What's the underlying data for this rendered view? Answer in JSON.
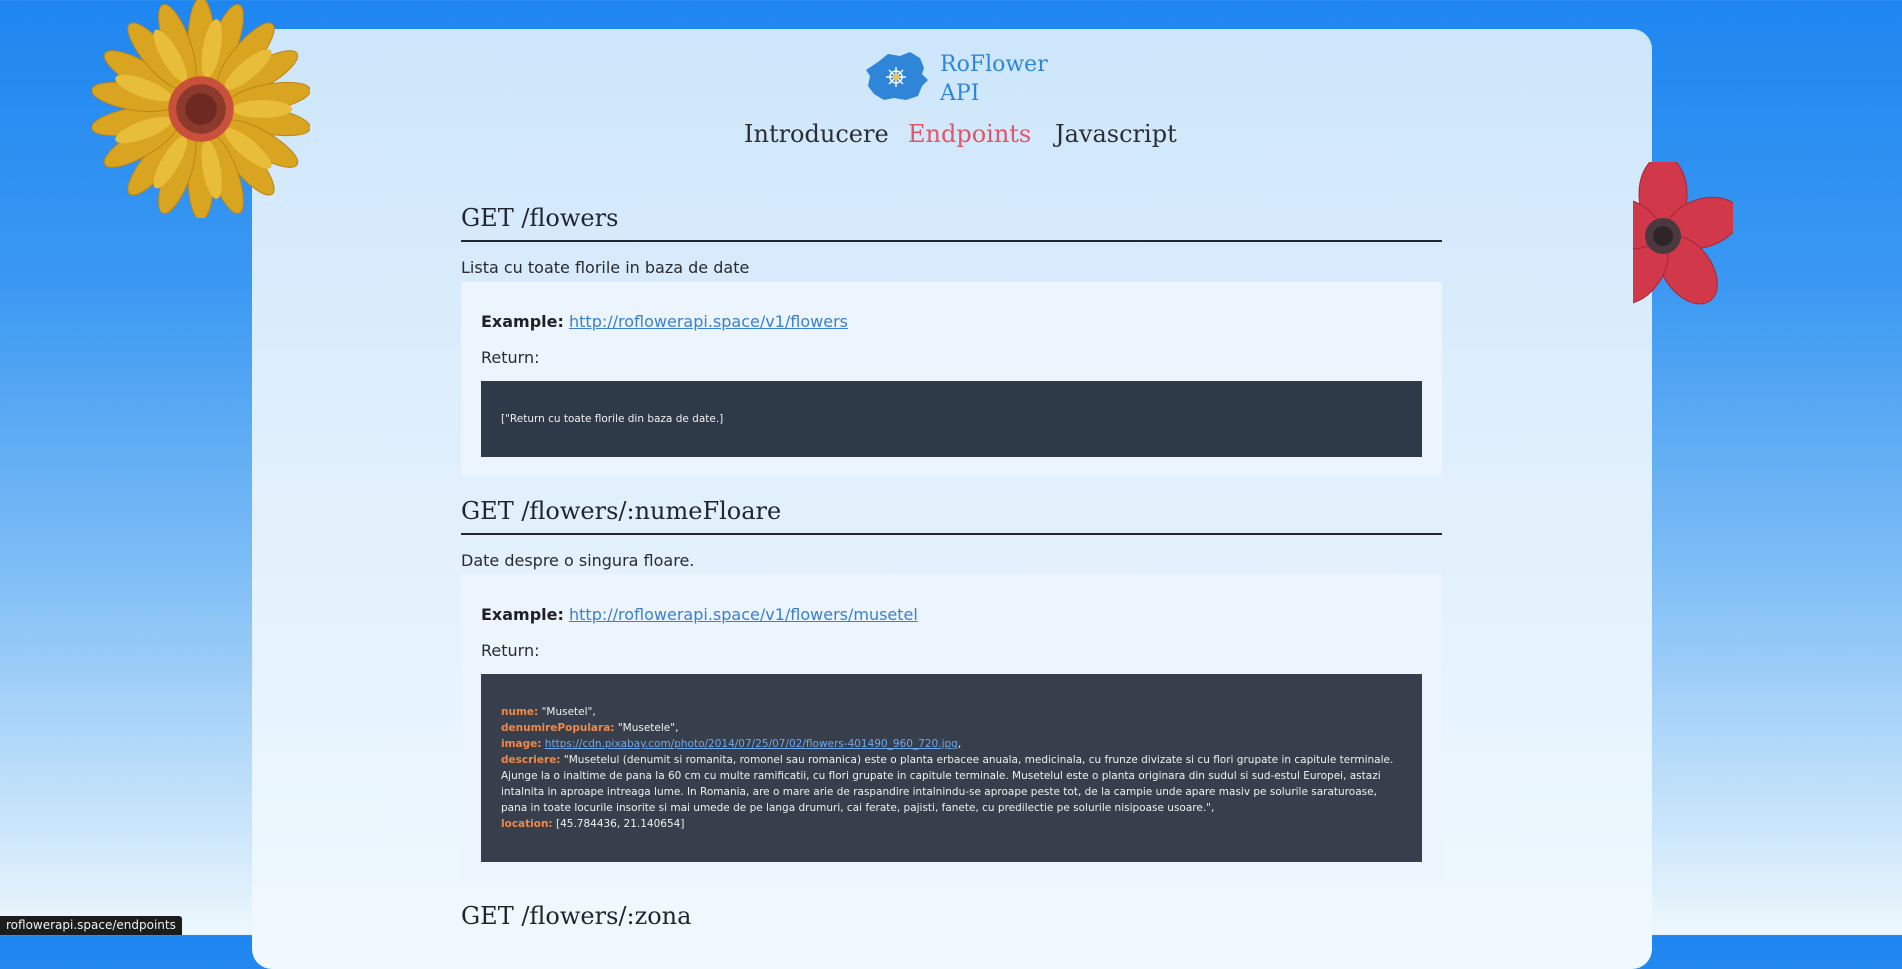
{
  "brand": {
    "line1": "RoFlower",
    "line2": "API"
  },
  "nav": {
    "items": [
      "Introducere",
      "Endpoints",
      "Javascript"
    ],
    "active": "Endpoints"
  },
  "sections": [
    {
      "title": "GET /flowers",
      "description": "Lista cu toate florile in baza de date",
      "example_label": "Example:",
      "example_url": "http://roflowerapi.space/v1/flowers",
      "return_label": "Return:",
      "code": "[\"Return cu toate florile din baza de date.]"
    },
    {
      "title": "GET /flowers/:numeFloare",
      "description": "Date despre o singura floare.",
      "example_label": "Example:",
      "example_url": "http://roflowerapi.space/v1/flowers/musetel",
      "return_label": "Return:",
      "code": {
        "nume_key": "nume:",
        "nume_val": "\"Musetel\",",
        "denumire_key": "denumirePopulara:",
        "denumire_val": "\"Musetele\",",
        "image_key": "image:",
        "image_val": "https://cdn.pixabay.com/photo/2014/07/25/07/02/flowers-401490_960_720.jpg",
        "image_comma": ",",
        "descriere_key": "descriere:",
        "descriere_val": "\"Musetelul (denumit si romanita, romonel sau romanica) este o planta erbacee anuala, medicinala, cu frunze divizate si cu flori grupate in capitule terminale. Ajunge la o inaltime de pana la 60 cm cu multe ramificatii, cu flori grupate in capitule terminale. Musetelul este o planta originara din sudul si sud-estul Europei, astazi intalnita in aproape intreaga lume. In Romania, are o mare arie de raspandire intalnindu-se aproape peste tot, de la campie unde apare masiv pe solurile saraturoase, pana in toate locurile insorite si mai umede de pe langa drumuri, cai ferate, pajisti, fanete, cu predilectie pe solurile nisipoase usoare.\",",
        "location_key": "location:",
        "location_val": "[45.784436, 21.140654]"
      }
    },
    {
      "title": "GET /flowers/:zona"
    }
  ],
  "status_bar": "roflowerapi.space/endpoints",
  "colors": {
    "accent": "#e2546a",
    "brand": "#2f86d8",
    "code_bg": "#2f3a48",
    "code_key": "#f0884a"
  }
}
